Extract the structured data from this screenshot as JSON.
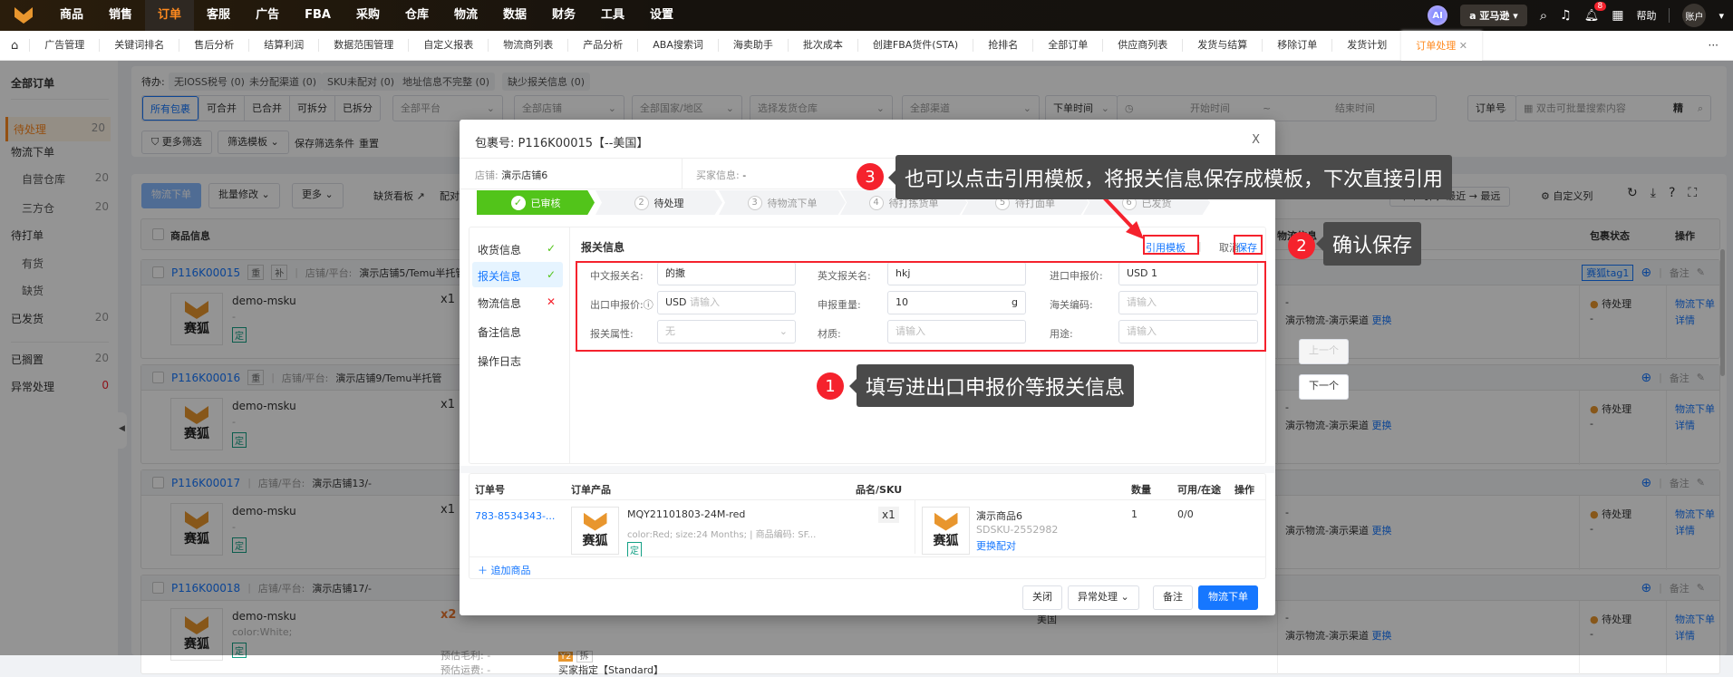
{
  "topnav": {
    "items": [
      "商品",
      "销售",
      "订单",
      "客服",
      "广告",
      "FBA",
      "采购",
      "仓库",
      "物流",
      "数据",
      "财务",
      "工具",
      "设置"
    ],
    "active_index": 2,
    "ai": "AI",
    "marketplace": "亚马逊",
    "notif_count": "8",
    "help": "帮助",
    "account": "账户"
  },
  "tabs": {
    "items": [
      "广告管理",
      "关键词排名",
      "售后分析",
      "结算利润",
      "数据范围管理",
      "自定义报表",
      "物流商列表",
      "产品分析",
      "ABA搜索词",
      "海卖助手",
      "批次成本",
      "创建FBA货件(STA)",
      "抢排名",
      "全部订单",
      "供应商列表",
      "发货与结算",
      "移除订单",
      "发货计划"
    ],
    "active": "订单处理",
    "more": "···"
  },
  "sidebar": {
    "title": "全部订单",
    "items": [
      {
        "label": "待处理",
        "count": "20"
      },
      {
        "label": "物流下单",
        "count": ""
      },
      {
        "label": "自营仓库",
        "count": "20"
      },
      {
        "label": "三方仓",
        "count": "20"
      },
      {
        "label": "待打单",
        "count": ""
      },
      {
        "label": "有货",
        "count": ""
      },
      {
        "label": "缺货",
        "count": ""
      },
      {
        "label": "已发货",
        "count": "20"
      },
      {
        "label": "已搁置",
        "count": "20"
      },
      {
        "label": "异常处理",
        "count": "0"
      }
    ]
  },
  "filters": {
    "todo_label": "待办:",
    "todo": [
      "无IOSS税号 (0)",
      "未分配渠道 (0)",
      "SKU未配对 (0)",
      "地址信息不完整 (0)",
      "缺少报关信息 (0)"
    ],
    "pkg_types": [
      "所有包裹",
      "可合并",
      "已合并",
      "可拆分",
      "已拆分"
    ],
    "platform": "全部平台",
    "store": "全部店铺",
    "country": "全部国家/地区",
    "warehouse": "选择发货仓库",
    "channel": "全部渠道",
    "time_type": "下单时间",
    "start": "开始时间",
    "tilde": "~",
    "end": "结束时间",
    "search_type": "订单号",
    "search_placeholder": "双击可批量搜索内容",
    "precise": "精",
    "more_filter": "更多筛选",
    "template": "筛选模板",
    "save": "保存筛选条件",
    "reset": "重置"
  },
  "toolbar": {
    "ship": "物流下单",
    "batch": "批量修改",
    "more": "更多",
    "shortage": "缺货看板",
    "match": "配对",
    "sort": "下单时间: 最近 → 最远",
    "custom_cols": "自定义列"
  },
  "table": {
    "col_product": "商品信息",
    "col_logistics": "物流信息",
    "col_status": "包裹状态",
    "col_ops": "操作"
  },
  "orders": [
    {
      "no": "P116K00015",
      "tags": [
        "重",
        "补"
      ],
      "store_label": "店铺/平台:",
      "store": "演示店铺5/Temu半托管",
      "sku": "demo-msku",
      "attr": "-",
      "qty": "x1",
      "ding": "定",
      "log1": "-",
      "log2": "演示物流-演示渠道",
      "change": "更换",
      "tag": "赛狐tag1",
      "status": "待处理",
      "status2": "-",
      "op1": "物流下单",
      "op2": "详情",
      "note": "备注"
    },
    {
      "no": "P116K00016",
      "tags": [
        "重"
      ],
      "store_label": "店铺/平台:",
      "store": "演示店铺9/Temu半托管",
      "sku": "demo-msku",
      "attr": "-",
      "qty": "x1",
      "ding": "定",
      "log1": "-",
      "log2": "演示物流-演示渠道",
      "change": "更换",
      "tag": "",
      "status": "待处理",
      "status2": "-",
      "op1": "物流下单",
      "op2": "详情",
      "note": "备注"
    },
    {
      "no": "P116K00017",
      "tags": [],
      "store_label": "店铺/平台:",
      "store": "演示店铺13/-",
      "sku": "demo-msku",
      "attr": "-",
      "qty": "x1",
      "ding": "定",
      "log1": "-",
      "log2": "演示物流-演示渠道",
      "change": "更换",
      "tag": "",
      "status": "待处理",
      "status2": "-",
      "op1": "物流下单",
      "op2": "详情",
      "note": "备注"
    },
    {
      "no": "P116K00018",
      "tags": [],
      "store_label": "店铺/平台:",
      "store": "演示店铺17/-",
      "sku": "demo-msku",
      "attr": "color:White;",
      "qty": "x2",
      "ding": "定",
      "log1": "-",
      "log2": "演示物流-演示渠道",
      "change": "更换",
      "tag": "",
      "status": "待处理",
      "status2": "-",
      "op1": "物流下单",
      "op2": "详情",
      "note": "备注",
      "profit": "预估毛利: -",
      "freight": "预估运费: -",
      "y2": "Y2",
      "split": "拆",
      "buyer_pref": "买家指定【Standard】",
      "country": "美国"
    }
  ],
  "modal": {
    "title": "包裹号: P116K00015【--美国】",
    "close": "X",
    "store_label": "店铺:",
    "store": "演示店铺6",
    "buyer_label": "买家信息:",
    "buyer": "-",
    "steps": [
      {
        "n": "",
        "label": "已审核"
      },
      {
        "n": "2",
        "label": "待处理"
      },
      {
        "n": "3",
        "label": "待物流下单"
      },
      {
        "n": "4",
        "label": "待打拣货单"
      },
      {
        "n": "5",
        "label": "待打面单"
      },
      {
        "n": "6",
        "label": "已发货"
      }
    ],
    "nav": [
      {
        "label": "收货信息",
        "state": "ok"
      },
      {
        "label": "报关信息",
        "state": "ok"
      },
      {
        "label": "物流信息",
        "state": "error"
      },
      {
        "label": "备注信息",
        "state": ""
      },
      {
        "label": "操作日志",
        "state": ""
      }
    ],
    "section_title": "报关信息",
    "use_template": "引用模板",
    "cancel": "取消",
    "save": "保存",
    "form": {
      "cn_name_label": "中文报关名:",
      "cn_name": "的撒",
      "en_name_label": "英文报关名:",
      "en_name": "hkj",
      "import_label": "进口申报价:",
      "import_cur": "USD",
      "import_val": "1",
      "export_label": "出口申报价:",
      "export_cur": "USD",
      "export_ph": "请输入",
      "weight_label": "申报重量:",
      "weight": "10",
      "weight_unit": "g",
      "hs_label": "海关编码:",
      "hs_ph": "请输入",
      "attr_label": "报关属性:",
      "attr": "无",
      "material_label": "材质:",
      "material_ph": "请输入",
      "usage_label": "用途:",
      "usage_ph": "请输入"
    },
    "items_table": {
      "headers": [
        "订单号",
        "订单产品",
        "品名/SKU",
        "数量",
        "可用/在途",
        "操作"
      ],
      "order_no": "783-8534343-...",
      "product": "MQY21101803-24M-red",
      "product_attr": "color:Red; size:24 Months; | 商品编码: SF...",
      "ding": "定",
      "qty_tag": "x1",
      "name": "演示商品6",
      "sku": "SDSKU-2552982",
      "rematch": "更换配对",
      "qty": "1",
      "avail": "0/0",
      "add": "追加商品",
      "logo": "赛狐"
    },
    "footer": {
      "close": "关闭",
      "exception": "异常处理",
      "note": "备注",
      "ship": "物流下单"
    }
  },
  "pager": {
    "prev": "上一个",
    "next": "下一个"
  },
  "callouts": [
    {
      "n": "1",
      "text": "填写进出口申报价等报关信息"
    },
    {
      "n": "2",
      "text": "确认保存"
    },
    {
      "n": "3",
      "text": "也可以点击引用模板，将报关信息保存成模板，下次直接引用"
    }
  ],
  "colors": {
    "brand": "#ff8a1f",
    "primary": "#1677ff",
    "success": "#52c41a",
    "annotation_red": "#f5222d"
  }
}
